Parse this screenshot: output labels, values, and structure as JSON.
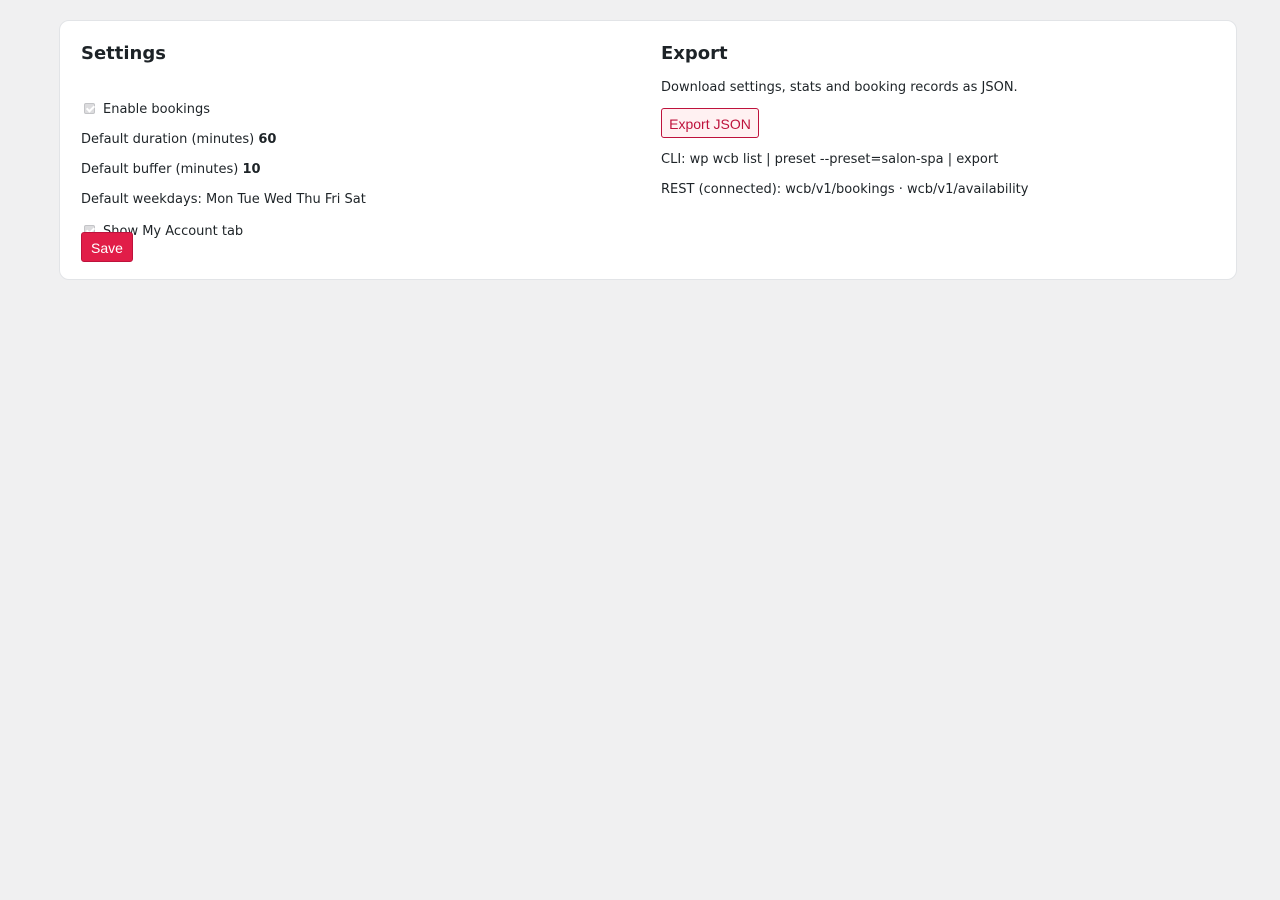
{
  "settings": {
    "title": "Settings",
    "enable_bookings": {
      "label": "Enable bookings",
      "checked": true
    },
    "default_duration": {
      "label": "Default duration (minutes)",
      "value": "60"
    },
    "default_buffer": {
      "label": "Default buffer (minutes)",
      "value": "10"
    },
    "default_weekdays": {
      "label": "Default weekdays:",
      "value": "Mon Tue Wed Thu Fri Sat"
    },
    "show_account_tab": {
      "label": "Show My Account tab",
      "checked": true
    },
    "save_label": "Save"
  },
  "export": {
    "title": "Export",
    "description": "Download settings, stats and booking records as JSON.",
    "export_label": "Export JSON",
    "cli_text": "CLI: wp wcb list | preset --preset=salon-spa | export",
    "rest_text": "REST (connected): wcb/v1/bookings · wcb/v1/availability"
  },
  "colors": {
    "accent": "#e11d48",
    "accent_dark": "#be123c",
    "background": "#f0f0f1",
    "card": "#ffffff"
  }
}
